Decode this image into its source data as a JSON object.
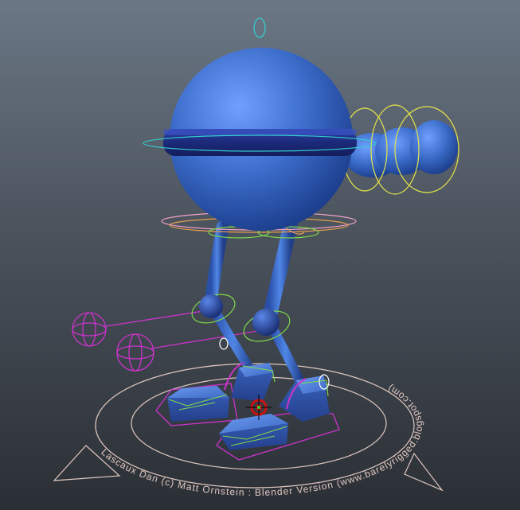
{
  "viewport": {
    "bg_top": "#6b7785",
    "bg_bottom": "#2b2f35"
  },
  "colors": {
    "body_blue": "#3a6bc8",
    "body_dark": "#1e2f8a",
    "ik_magenta": "#cc33cc",
    "ctrl_yellow": "#e6e64a",
    "ctrl_green": "#7fd94a",
    "ctrl_cyan": "#33cccc",
    "ctrl_pink": "#f0a0c8",
    "root_outline": "#e0c8c0"
  },
  "root_control": {
    "ring_text": "Lascaux Dan (c) Matt Ornstein : Blender Version (www.barelyrigged.blogspot.com)"
  }
}
